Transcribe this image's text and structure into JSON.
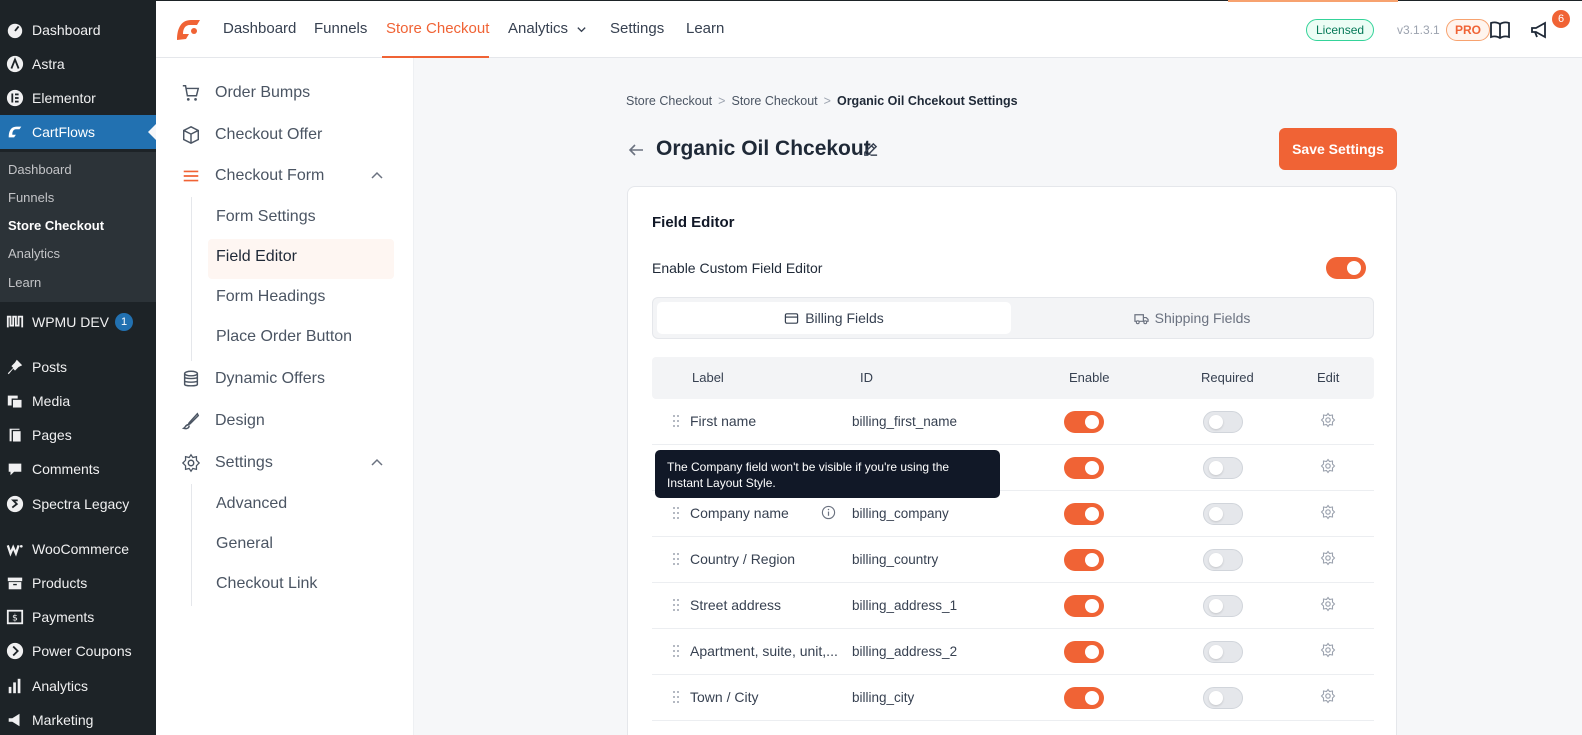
{
  "wp_sidebar": {
    "top_items": [
      {
        "label": "Dashboard",
        "icon": "dashboard-icon"
      },
      {
        "label": "Astra",
        "icon": "astra-icon"
      },
      {
        "label": "Elementor",
        "icon": "elementor-icon"
      },
      {
        "label": "CartFlows",
        "icon": "cartflows-icon"
      }
    ],
    "submenu": [
      "Dashboard",
      "Funnels",
      "Store Checkout",
      "Analytics",
      "Learn"
    ],
    "submenu_current": "Store Checkout",
    "wpmu": {
      "label": "WPMU DEV",
      "badge": "1"
    },
    "bottom_items": [
      {
        "label": "Posts",
        "icon": "pin-icon"
      },
      {
        "label": "Media",
        "icon": "media-icon"
      },
      {
        "label": "Pages",
        "icon": "pages-icon"
      },
      {
        "label": "Comments",
        "icon": "comments-icon"
      },
      {
        "label": "Spectra Legacy",
        "icon": "spectra-icon"
      },
      {
        "label": "WooCommerce",
        "icon": "woocommerce-icon"
      },
      {
        "label": "Products",
        "icon": "products-icon"
      },
      {
        "label": "Payments",
        "icon": "payments-icon"
      },
      {
        "label": "Power Coupons",
        "icon": "coupons-icon"
      },
      {
        "label": "Analytics",
        "icon": "analytics-icon"
      },
      {
        "label": "Marketing",
        "icon": "marketing-icon"
      }
    ]
  },
  "topbar": {
    "nav": [
      "Dashboard",
      "Funnels",
      "Store Checkout",
      "Analytics",
      "Settings",
      "Learn"
    ],
    "active": "Store Checkout",
    "licensed": "Licensed",
    "version": "v3.1.3.1",
    "pro": "PRO",
    "notifications": "6"
  },
  "settings_nav": {
    "items": {
      "order_bumps": "Order Bumps",
      "checkout_offer": "Checkout Offer",
      "checkout_form": "Checkout Form",
      "dynamic_offers": "Dynamic Offers",
      "design": "Design",
      "settings": "Settings"
    },
    "checkout_form_sub": [
      "Form Settings",
      "Field Editor",
      "Form Headings",
      "Place Order Button"
    ],
    "settings_sub": [
      "Advanced",
      "General",
      "Checkout Link"
    ],
    "active_sub": "Field Editor"
  },
  "breadcrumb": {
    "items": [
      "Store Checkout",
      "Store Checkout"
    ],
    "current": "Organic Oil Chcekout Settings",
    "separator": ">"
  },
  "page": {
    "title": "Organic Oil Chcekout",
    "save_label": "Save Settings"
  },
  "field_editor": {
    "title": "Field Editor",
    "enable_label": "Enable Custom Field Editor",
    "enable_on": true,
    "tabs": [
      "Billing Fields",
      "Shipping Fields"
    ],
    "active_tab": "Billing Fields",
    "columns": [
      "Label",
      "ID",
      "Enable",
      "Required",
      "Edit"
    ],
    "rows": [
      {
        "label": "First name",
        "id": "billing_first_name",
        "enabled": true,
        "required": false
      },
      {
        "label": "",
        "id": "",
        "enabled": true,
        "required": false
      },
      {
        "label": "Company name",
        "id": "billing_company",
        "enabled": true,
        "required": false
      },
      {
        "label": "Country / Region",
        "id": "billing_country",
        "enabled": true,
        "required": false
      },
      {
        "label": "Street address",
        "id": "billing_address_1",
        "enabled": true,
        "required": false
      },
      {
        "label": "Apartment, suite, unit,...",
        "id": "billing_address_2",
        "enabled": true,
        "required": false
      },
      {
        "label": "Town / City",
        "id": "billing_city",
        "enabled": true,
        "required": false
      }
    ],
    "tooltip": "The Company field won't be visible if you're using the Instant Layout Style."
  },
  "colors": {
    "accent": "#f06335",
    "wp_sidebar": "#1d2327",
    "wp_active": "#2271b1"
  }
}
